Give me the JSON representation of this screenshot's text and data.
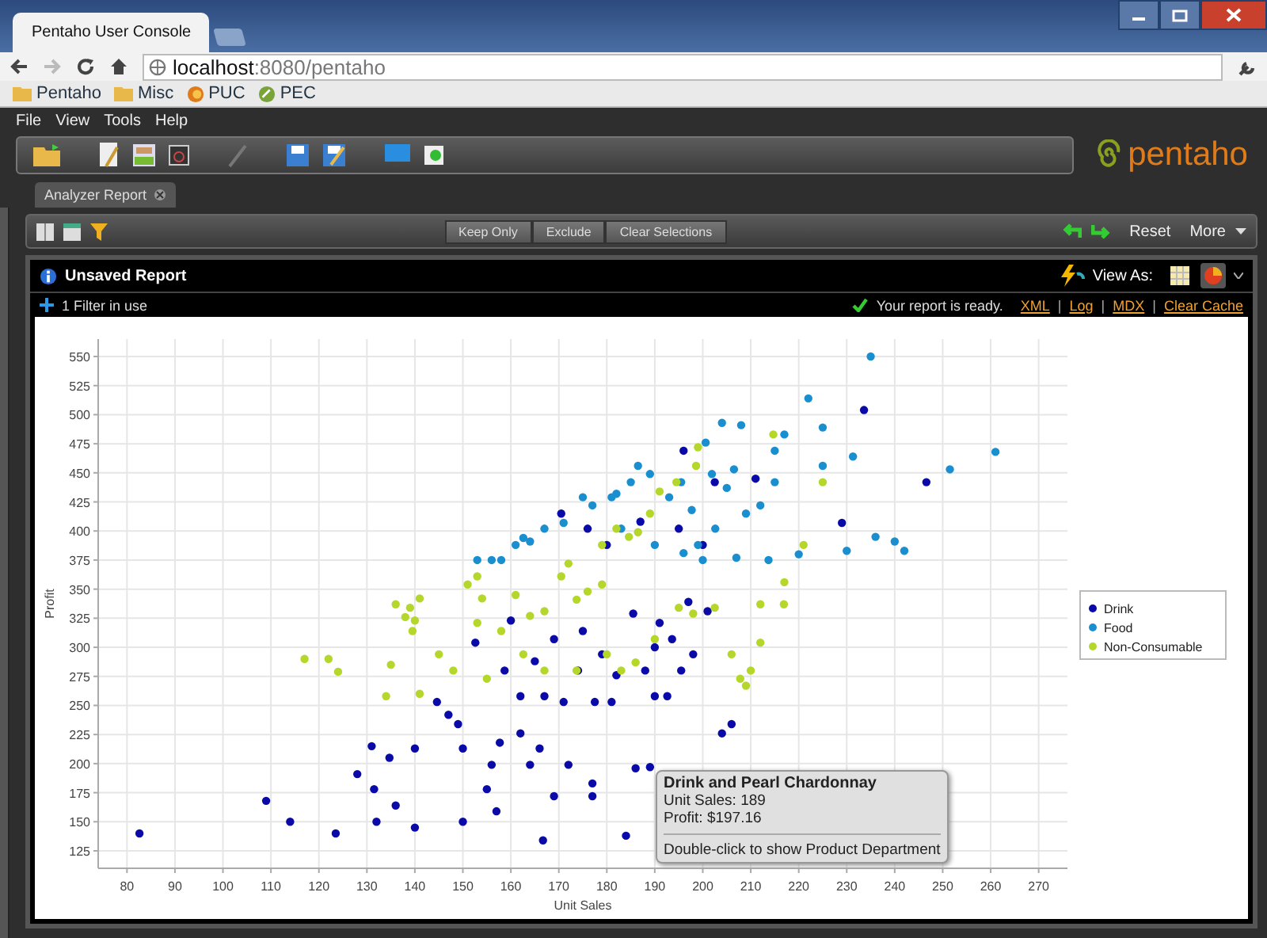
{
  "browser": {
    "tab_title": "Pentaho User Console",
    "url_host": "localhost",
    "url_rest": ":8080/pentaho",
    "bookmarks": [
      {
        "kind": "folder",
        "label": "Pentaho"
      },
      {
        "kind": "folder",
        "label": "Misc"
      },
      {
        "kind": "puc",
        "label": "PUC"
      },
      {
        "kind": "pec",
        "label": "PEC"
      }
    ]
  },
  "app": {
    "menu": [
      "File",
      "View",
      "Tools",
      "Help"
    ],
    "logo": "pentaho",
    "tab": "Analyzer Report"
  },
  "report_toolbar": {
    "buttons": [
      "Keep Only",
      "Exclude",
      "Clear Selections"
    ],
    "reset": "Reset",
    "more": "More"
  },
  "report": {
    "title": "Unsaved Report",
    "view_as": "View As:",
    "view_modes": [
      {
        "kind": "table",
        "selected": false
      },
      {
        "kind": "chart",
        "selected": true
      }
    ],
    "filter": "1 Filter in use",
    "status": "Your report is ready.",
    "links": [
      "XML",
      "Log",
      "MDX",
      "Clear Cache"
    ],
    "link_separator": "|"
  },
  "chart_data": {
    "type": "scatter",
    "grid": true,
    "legend": "right",
    "xlabel": "Unit Sales",
    "ylabel": "Profit",
    "xlim": [
      74,
      276
    ],
    "ylim": [
      110,
      565
    ],
    "xticks": [
      80,
      90,
      100,
      110,
      120,
      130,
      140,
      150,
      160,
      170,
      180,
      190,
      200,
      210,
      220,
      230,
      240,
      250,
      260,
      270
    ],
    "yticks": [
      125,
      150,
      175,
      200,
      225,
      250,
      275,
      300,
      325,
      350,
      375,
      400,
      425,
      450,
      475,
      500,
      525,
      550
    ],
    "series": [
      {
        "name": "Drink",
        "color": "#0a0aa8",
        "x": [
          82.6,
          109,
          114,
          123.5,
          128,
          131,
          131.5,
          132,
          134.7,
          136,
          140,
          140,
          144.6,
          147,
          149,
          150,
          150,
          152.6,
          155,
          156,
          157,
          157.7,
          158.7,
          160,
          162,
          162,
          164,
          165,
          166,
          166.7,
          167,
          169,
          169,
          170.5,
          171,
          172,
          174,
          175,
          176,
          177,
          177.5,
          179,
          177,
          180,
          181,
          182,
          184,
          185.5,
          186,
          187,
          188,
          190,
          190,
          191,
          192.6,
          193.6,
          195,
          195.5,
          197,
          198,
          200,
          201,
          204,
          206,
          211,
          202.5,
          229,
          233.6,
          246.6,
          196,
          189
        ],
        "values": [
          140,
          168,
          150,
          140,
          191,
          215,
          178,
          150,
          205,
          164,
          213,
          145,
          253,
          242,
          234,
          150,
          213,
          304,
          178,
          199,
          159,
          218,
          280,
          323,
          258,
          226,
          199,
          288,
          213,
          134,
          258,
          307,
          172,
          415,
          253,
          199,
          280,
          314,
          402,
          172,
          253,
          294,
          183,
          388,
          253,
          276,
          138,
          329,
          196,
          408,
          280,
          258,
          300,
          321,
          258,
          307,
          402,
          280,
          339,
          294,
          388,
          331,
          226,
          234,
          445,
          442,
          407,
          504,
          442,
          469,
          197
        ]
      },
      {
        "name": "Food",
        "color": "#1a8fd0",
        "x": [
          235,
          222,
          217,
          200.6,
          204,
          208,
          206.5,
          215,
          225,
          231.3,
          261,
          251.5,
          236,
          240,
          242,
          230,
          220,
          213.7,
          207,
          199,
          195.5,
          193,
          189,
          185,
          181,
          177,
          171,
          167,
          164,
          161,
          158,
          153,
          156,
          162.6,
          183,
          190,
          196,
          202.6,
          209,
          212,
          200,
          186.5,
          182,
          175,
          225,
          205,
          215,
          201.9,
          197.7
        ],
        "values": [
          550,
          514,
          483,
          476,
          493,
          491,
          453,
          442,
          456,
          464,
          468,
          453,
          395,
          391,
          383,
          383,
          380,
          375,
          377,
          388,
          442,
          429,
          449,
          442,
          429,
          422,
          407,
          402,
          391,
          388,
          375,
          375,
          375,
          394,
          402,
          388,
          381,
          402,
          415,
          422,
          375,
          456,
          432,
          429,
          489,
          437,
          469,
          449,
          418
        ]
      },
      {
        "name": "Non-Consumable",
        "color": "#b5d62a",
        "x": [
          117,
          122,
          124,
          134,
          136,
          138,
          139,
          140,
          141,
          139.5,
          135,
          141,
          145,
          148,
          151,
          153,
          153,
          154,
          155,
          158,
          161,
          162.6,
          167,
          170.5,
          172,
          173.7,
          176,
          179,
          179,
          182,
          184.6,
          186.5,
          189,
          191,
          194.5,
          199,
          198.6,
          180,
          183,
          186,
          190,
          195,
          198,
          202.5,
          206,
          207.8,
          210,
          212,
          212,
          217,
          216.9,
          214.7,
          221,
          225,
          209,
          167,
          164,
          173.7
        ],
        "values": [
          290,
          290,
          279,
          258,
          337,
          326,
          334,
          323,
          342,
          314,
          285,
          260,
          294,
          280,
          354,
          361,
          321,
          342,
          273,
          314,
          345,
          294,
          331,
          361,
          372,
          341,
          348,
          354,
          388,
          402,
          395,
          399,
          415,
          434,
          442,
          472,
          456,
          294,
          280,
          287,
          307,
          334,
          329,
          334,
          294,
          273,
          280,
          337,
          304,
          356,
          337,
          483,
          388,
          442,
          267,
          280,
          327,
          280
        ]
      }
    ]
  },
  "tooltip": {
    "title": "Drink and Pearl Chardonnay",
    "lines": [
      "Unit Sales: 189",
      "Profit: $197.16"
    ],
    "hint": "Double-click to show Product Department"
  }
}
